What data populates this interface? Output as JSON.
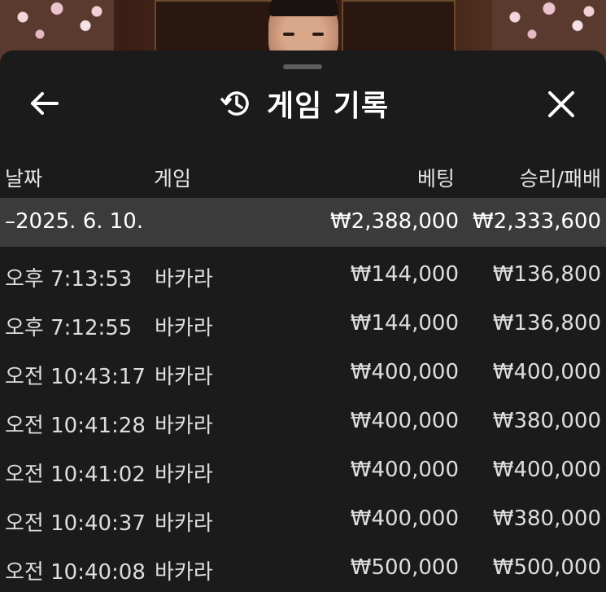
{
  "header": {
    "title": "게임 기록",
    "back_icon": "arrow-left-icon",
    "history_icon": "history-icon",
    "close_icon": "close-icon"
  },
  "columns": {
    "date": "날짜",
    "game": "게임",
    "bet": "베팅",
    "win_loss": "승리/패배"
  },
  "group": {
    "date": "–2025. 6. 10.",
    "bet_total": "₩2,388,000",
    "win_total": "₩2,333,600"
  },
  "rows": [
    {
      "time": "오후 7:13:53",
      "game": "바카라",
      "bet": "₩144,000",
      "win": "₩136,800"
    },
    {
      "time": "오후 7:12:55",
      "game": "바카라",
      "bet": "₩144,000",
      "win": "₩136,800"
    },
    {
      "time": "오전 10:43:17",
      "game": "바카라",
      "bet": "₩400,000",
      "win": "₩400,000"
    },
    {
      "time": "오전 10:41:28",
      "game": "바카라",
      "bet": "₩400,000",
      "win": "₩380,000"
    },
    {
      "time": "오전 10:41:02",
      "game": "바카라",
      "bet": "₩400,000",
      "win": "₩400,000"
    },
    {
      "time": "오전 10:40:37",
      "game": "바카라",
      "bet": "₩400,000",
      "win": "₩380,000"
    },
    {
      "time": "오전 10:40:08",
      "game": "바카라",
      "bet": "₩500,000",
      "win": "₩500,000"
    }
  ],
  "colors": {
    "sheet_bg": "#1b1b1b",
    "group_row_bg": "#3b3b3b",
    "text": "#ffffff"
  }
}
